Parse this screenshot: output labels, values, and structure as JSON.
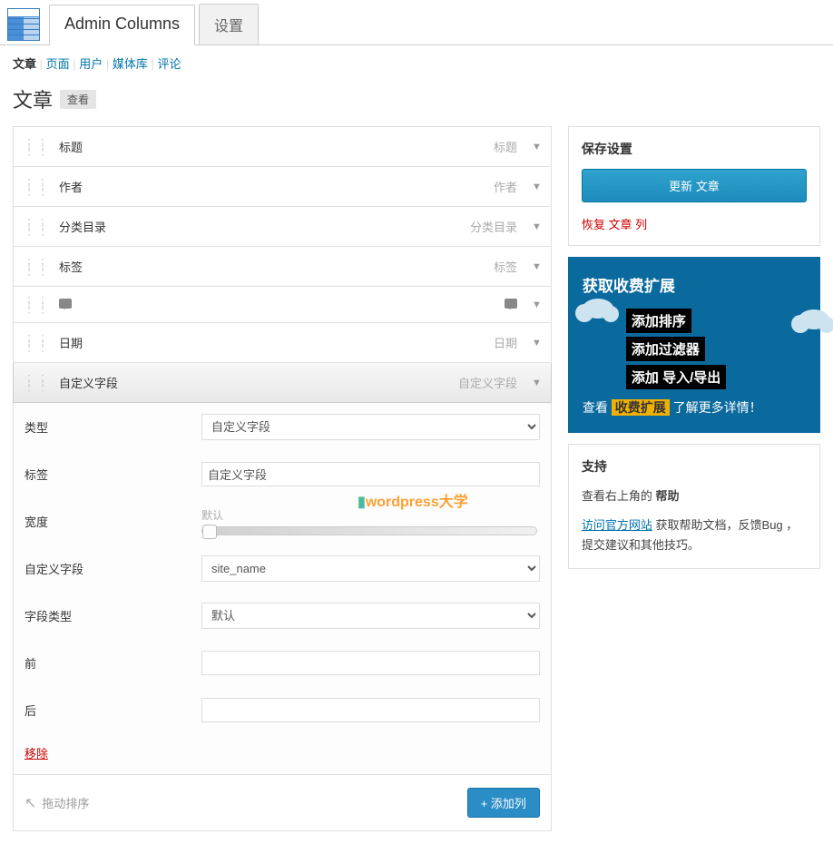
{
  "tabs": {
    "main": "Admin Columns",
    "settings": "设置"
  },
  "subnav": {
    "current": "文章",
    "items": [
      "页面",
      "用户",
      "媒体库",
      "评论"
    ]
  },
  "title": "文章",
  "view_badge": "查看",
  "columns": [
    {
      "label": "标题",
      "type": "标题"
    },
    {
      "label": "作者",
      "type": "作者"
    },
    {
      "label": "分类目录",
      "type": "分类目录"
    },
    {
      "label": "标签",
      "type": "标签"
    },
    {
      "label": "__comment_icon__",
      "type": "__comment_icon__"
    },
    {
      "label": "日期",
      "type": "日期"
    },
    {
      "label": "自定义字段",
      "type": "自定义字段",
      "expanded": true
    }
  ],
  "form": {
    "type_label": "类型",
    "type_value": "自定义字段",
    "label_label": "标签",
    "label_value": "自定义字段",
    "width_label": "宽度",
    "width_value": "默认",
    "cf_label": "自定义字段",
    "cf_value": "site_name",
    "ft_label": "字段类型",
    "ft_value": "默认",
    "before_label": "前",
    "before_value": "",
    "after_label": "后",
    "after_value": "",
    "remove": "移除"
  },
  "footer": {
    "sort_hint": "拖动排序",
    "add_col": "+ 添加列"
  },
  "save_box": {
    "title": "保存设置",
    "button": "更新 文章",
    "restore": "恢复 文章 列"
  },
  "promo": {
    "title": "获取收费扩展",
    "lines": [
      "添加排序",
      "添加过滤器",
      "添加 导入/导出"
    ],
    "footer_pre": "查看 ",
    "footer_mid": "收费扩展",
    "footer_post": " 了解更多详情！"
  },
  "support": {
    "title": "支持",
    "line1_pre": "查看右上角的 ",
    "line1_bold": "帮助",
    "link": "访问官方网站",
    "text2": " 获取帮助文档，反馈Bug ，提交建议和其他技巧。"
  }
}
